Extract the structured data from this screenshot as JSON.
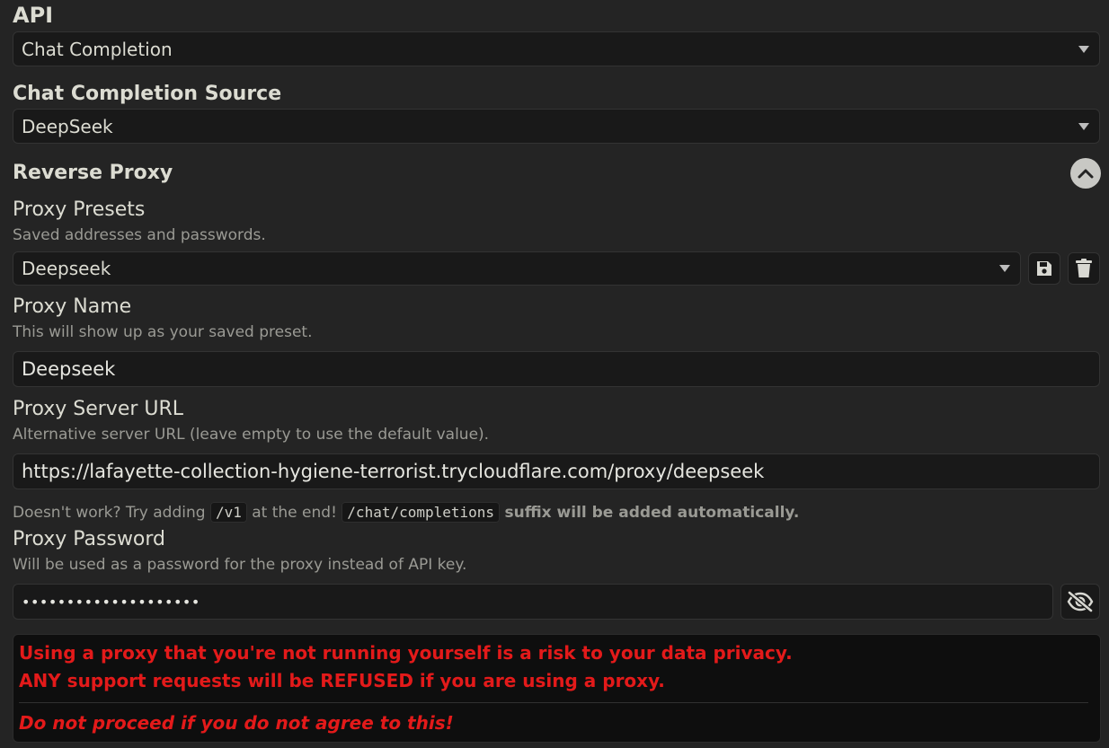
{
  "api": {
    "label": "API",
    "selected": "Chat Completion"
  },
  "source": {
    "label": "Chat Completion Source",
    "selected": "DeepSeek"
  },
  "reverse_proxy": {
    "title": "Reverse Proxy",
    "collapse_icon": "chevron-up-icon"
  },
  "presets": {
    "label": "Proxy Presets",
    "description": "Saved addresses and passwords.",
    "selected": "Deepseek",
    "save_icon": "floppy-disk-icon",
    "delete_icon": "trash-icon"
  },
  "proxy_name": {
    "label": "Proxy Name",
    "description": "This will show up as your saved preset.",
    "value": "Deepseek"
  },
  "proxy_url": {
    "label": "Proxy Server URL",
    "description": "Alternative server URL (leave empty to use the default value).",
    "value": "https://lafayette-collection-hygiene-terrorist.trycloudflare.com/proxy/deepseek",
    "hint_prefix": "Doesn't work? Try adding",
    "hint_code1": "/v1",
    "hint_middle": "at the end!",
    "hint_code2": "/chat/completions",
    "hint_suffix": "suffix will be added automatically."
  },
  "proxy_password": {
    "label": "Proxy Password",
    "description": "Will be used as a password for the proxy instead of API key.",
    "value": "••••••••••••••••••••",
    "toggle_icon": "eye-slash-icon"
  },
  "warning": {
    "line1": "Using a proxy that you're not running yourself is a risk to your data privacy.",
    "line2": "ANY support requests will be REFUSED if you are using a proxy.",
    "line3": "Do not proceed if you do not agree to this!",
    "color": "#e31a1a"
  }
}
